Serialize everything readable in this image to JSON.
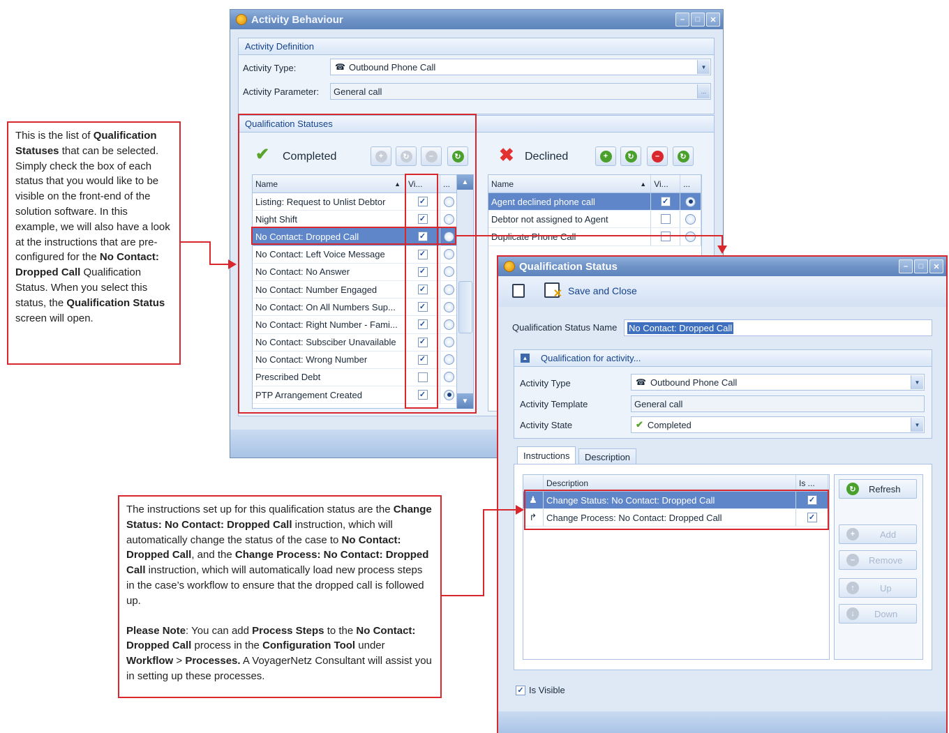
{
  "activity_window": {
    "title": "Activity Behaviour",
    "definition": {
      "header": "Activity Definition",
      "type_label": "Activity Type:",
      "type_value": "Outbound Phone Call",
      "param_label": "Activity Parameter:",
      "param_value": "General call"
    },
    "qualification": {
      "header": "Qualification Statuses",
      "completed_label": "Completed",
      "declined_label": "Declined",
      "col_name": "Name",
      "col_visible": "Vi...",
      "col_more": "...",
      "completed_rows": [
        {
          "name": "Listing: Request to Unlist Debtor",
          "visible": true,
          "default": false
        },
        {
          "name": "Night Shift",
          "visible": true,
          "default": false
        },
        {
          "name": "No Contact: Dropped Call",
          "visible": true,
          "default": false
        },
        {
          "name": "No Contact: Left Voice Message",
          "visible": true,
          "default": false
        },
        {
          "name": "No Contact: No Answer",
          "visible": true,
          "default": false
        },
        {
          "name": "No Contact: Number Engaged",
          "visible": true,
          "default": false
        },
        {
          "name": "No Contact: On All Numbers Sup...",
          "visible": true,
          "default": false
        },
        {
          "name": "No Contact: Right Number - Fami...",
          "visible": true,
          "default": false
        },
        {
          "name": "No Contact: Subsciber Unavailable",
          "visible": true,
          "default": false
        },
        {
          "name": "No Contact: Wrong Number",
          "visible": true,
          "default": false
        },
        {
          "name": "Prescribed Debt",
          "visible": false,
          "default": false
        },
        {
          "name": "PTP Arrangement Created",
          "visible": true,
          "default": true
        }
      ],
      "declined_rows": [
        {
          "name": "Agent declined phone call",
          "visible": true,
          "default": true
        },
        {
          "name": "Debtor not assigned to Agent",
          "visible": false,
          "default": false
        },
        {
          "name": "Duplicate Phone Call",
          "visible": false,
          "default": false
        }
      ]
    }
  },
  "qs_window": {
    "title": "Qualification Status",
    "save_close": "Save and Close",
    "name_label": "Qualification Status Name",
    "name_value": "No Contact: Dropped Call",
    "group_header": "Qualification for activity...",
    "type_label": "Activity Type",
    "type_value": "Outbound Phone Call",
    "template_label": "Activity Template",
    "template_value": "General call",
    "state_label": "Activity State",
    "state_value": "Completed",
    "tabs": [
      "Instructions",
      "Description"
    ],
    "col_description": "Description",
    "col_is": "Is ...",
    "instructions": [
      {
        "text": "Change Status: No Contact: Dropped Call",
        "checked": true
      },
      {
        "text": "Change Process: No Contact: Dropped Call",
        "checked": true
      }
    ],
    "buttons": {
      "refresh": "Refresh",
      "add": "Add",
      "remove": "Remove",
      "up": "Up",
      "down": "Down"
    },
    "is_visible": "Is Visible"
  },
  "callouts": {
    "left": {
      "t1": "This is the list of ",
      "b1": "Qualification Statuses",
      "t2": " that can be selected. Simply check the box of each status that you would like to be visible on the front-end of the solution software. In this example, we will also have a look at the instructions that are pre-configured for the ",
      "b2": "No Contact: Dropped Call",
      "t3": " Qualification Status. When you select this status, the ",
      "b3": "Qualification Status",
      "t4": " screen will open."
    },
    "bottom": {
      "t1": "The instructions set up for this qualification status are the ",
      "b1": "Change Status: No Contact: Dropped Call",
      "t2": " instruction, which will automatically change the status of the case to ",
      "b2": "No Contact: Dropped Call",
      "t3": ", and the ",
      "b3": "Change Process: No Contact: Dropped Call",
      "t4": " instruction, which will automatically load new process steps in the case’s workflow to ensure that the dropped call is followed up.",
      "n_b1": "Please Note",
      "n_t1": ": You can add ",
      "n_b2": "Process Steps",
      "n_t2": " to the ",
      "n_b3": "No Contact: Dropped Call",
      "n_t3": " process in the ",
      "n_b4": "Configuration Tool",
      "n_t4": " under ",
      "n_b5": "Workflow",
      "n_t5": " > ",
      "n_b6": "Processes.",
      "n_t6": " A VoyagerNetz Consultant will assist you in setting up these processes."
    }
  },
  "colors": {
    "accent": "#5f86c8",
    "callout_border": "#d9282d",
    "title_bar": "#6f93c6"
  }
}
